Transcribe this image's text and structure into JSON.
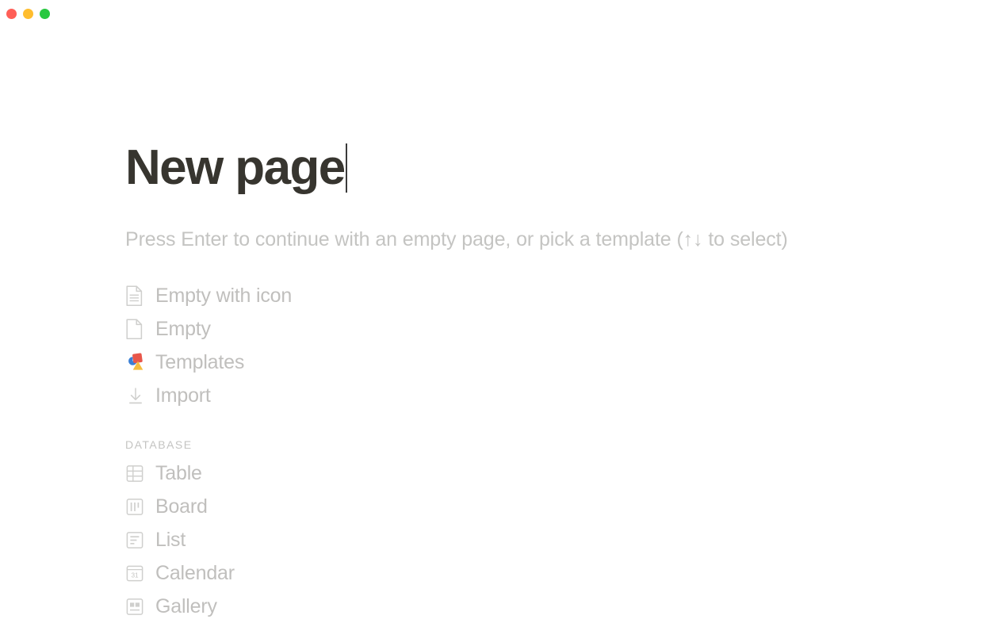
{
  "window": {
    "traffic_lights": [
      {
        "name": "close",
        "color": "#FF5F57"
      },
      {
        "name": "minimize",
        "color": "#FFBD2E"
      },
      {
        "name": "maximize",
        "color": "#28C840"
      }
    ]
  },
  "page": {
    "title": "New page",
    "hint": "Press Enter to continue with an empty page, or pick a template (↑↓ to select)"
  },
  "options": {
    "primary": [
      {
        "label": "Empty with icon",
        "icon": "document-lines-icon"
      },
      {
        "label": "Empty",
        "icon": "document-blank-icon"
      },
      {
        "label": "Templates",
        "icon": "templates-shapes-icon"
      },
      {
        "label": "Import",
        "icon": "download-arrow-icon"
      }
    ],
    "database_header": "DATABASE",
    "database": [
      {
        "label": "Table",
        "icon": "table-grid-icon"
      },
      {
        "label": "Board",
        "icon": "board-columns-icon"
      },
      {
        "label": "List",
        "icon": "list-lines-icon"
      },
      {
        "label": "Calendar",
        "icon": "calendar-31-icon"
      },
      {
        "label": "Gallery",
        "icon": "gallery-grid-icon"
      }
    ]
  },
  "colors": {
    "title_text": "#37352f",
    "muted_text": "#c0bfbd",
    "icon_stroke": "#cfcfcd",
    "templates_blue": "#3a7fd5",
    "templates_red": "#e8564a",
    "templates_yellow": "#f5bd3f",
    "background": "#ffffff"
  }
}
